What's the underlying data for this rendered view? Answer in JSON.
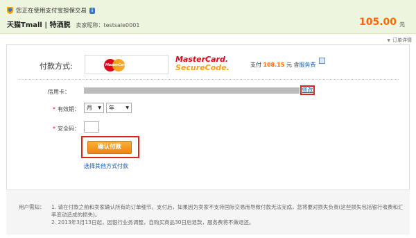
{
  "header": {
    "secure_notice": "您正在使用支付宝担保交易",
    "store_name": "天猫Tmall | 特洒脱",
    "seller_nickname": "卖家昵称：testsale0001",
    "amount": "105.00",
    "currency_unit": "元",
    "order_detail_label": "订单详情"
  },
  "payment": {
    "method_label": "付款方式:",
    "card_brand_logo_text": "MasterCard",
    "securecode_line1": "MasterCard.",
    "securecode_line2": "SecureCode.",
    "pay_prefix": "支付",
    "pay_amount": "108.15",
    "pay_suffix": "元 含",
    "fee_link": "服务费"
  },
  "form": {
    "card_label": "信用卡：",
    "modify_link": "修改",
    "expiry_label": "有效期：",
    "month_select": "月",
    "year_select": "年",
    "cvv_label": "安全码：",
    "confirm_button": "确认付款",
    "other_method_link": "选择其他方式付款"
  },
  "notice": {
    "label": "用户需知：",
    "line1": "1. 请在付款之前和卖家确认所有的订单细节。支付后，如果因为卖家不支持国际交易而导致付款无法完成，您将要对损失负责(这些损失包括银行收费和汇率变动造成的损失)。",
    "line2": "2. 2013年3月13日起，因银行业务调整，自购买商品30日后退款，服务费将不做退还。"
  },
  "colors": {
    "accent_orange": "#ff6600",
    "highlight_red": "#d9231b",
    "link_blue": "#1a5ca8"
  }
}
